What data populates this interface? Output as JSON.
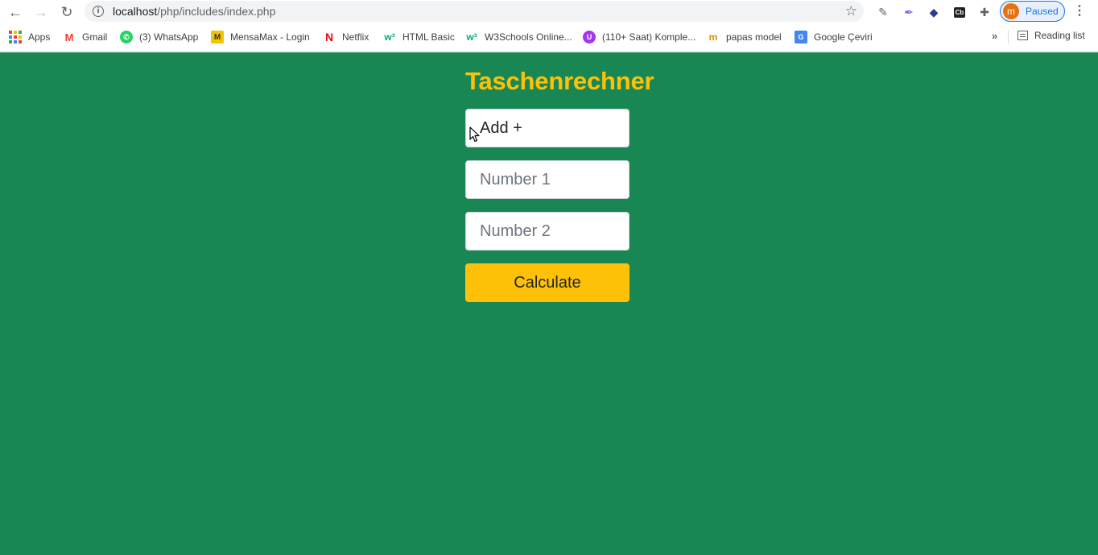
{
  "browser": {
    "url_host": "localhost",
    "url_path": "/php/includes/index.php",
    "profile_initial": "m",
    "profile_status": "Paused",
    "extensions": [
      "eyedropper-icon",
      "feather-icon",
      "layers-icon",
      "cb-icon",
      "puzzle-icon"
    ],
    "ext_cb_text": "Cb"
  },
  "bookmarks": {
    "items": [
      {
        "label": "Apps",
        "icon": "apps-grid-icon"
      },
      {
        "label": "Gmail",
        "icon": "gmail-icon"
      },
      {
        "label": "(3) WhatsApp",
        "icon": "whatsapp-icon"
      },
      {
        "label": "MensaMax - Login",
        "icon": "mensamax-icon"
      },
      {
        "label": "Netflix",
        "icon": "netflix-icon"
      },
      {
        "label": "HTML Basic",
        "icon": "w3schools-icon"
      },
      {
        "label": "W3Schools Online...",
        "icon": "w3schools-icon"
      },
      {
        "label": "(110+ Saat) Komple...",
        "icon": "udemy-icon"
      },
      {
        "label": "papas model",
        "icon": "papas-icon"
      },
      {
        "label": "Google Çeviri",
        "icon": "google-translate-icon"
      }
    ],
    "reading_list": "Reading list"
  },
  "page": {
    "title": "Taschenrechner",
    "operation_select": "Add +",
    "number1_placeholder": "Number 1",
    "number2_placeholder": "Number 2",
    "calculate_label": "Calculate"
  },
  "colors": {
    "background": "#198754",
    "accent": "#ffc107"
  }
}
